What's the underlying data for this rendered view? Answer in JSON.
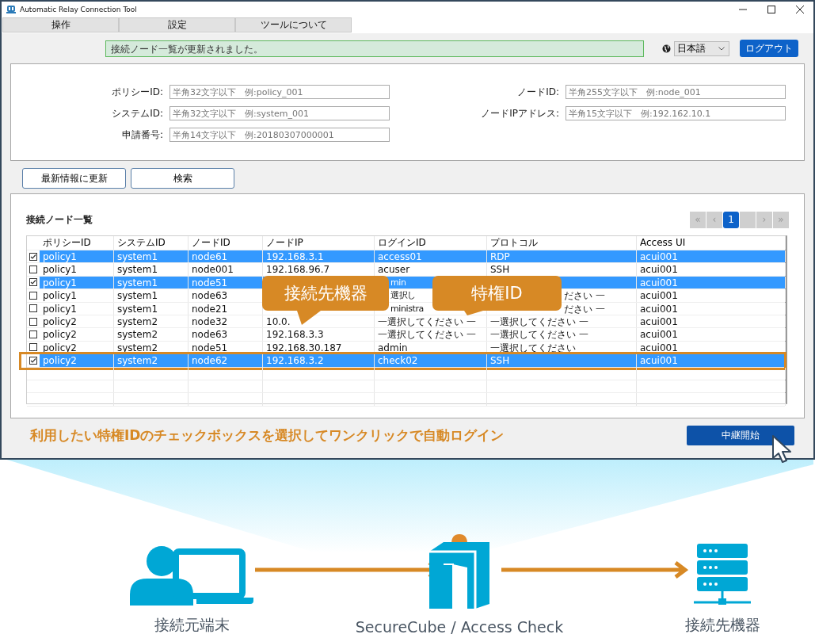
{
  "window": {
    "title": "Automatic Relay Connection Tool"
  },
  "menu_tabs": [
    {
      "label": "操作"
    },
    {
      "label": "設定"
    },
    {
      "label": "ツールについて"
    }
  ],
  "status_message": "接続ノード一覧が更新されました。",
  "language_select": {
    "value": "日本語"
  },
  "logout_button": "ログアウト",
  "search_fields_left": [
    {
      "label": "ポリシーID:",
      "placeholder": "半角32文字以下　例:policy_001"
    },
    {
      "label": "システムID:",
      "placeholder": "半角32文字以下　例:system_001"
    },
    {
      "label": "申請番号:",
      "placeholder": "半角14文字以下　例:20180307000001"
    }
  ],
  "search_fields_right": [
    {
      "label": "ノードID:",
      "placeholder": "半角255文字以下　例:node_001"
    },
    {
      "label": "ノードIPアドレス:",
      "placeholder": "半角15文字以下　例:192.162.10.1"
    }
  ],
  "buttons": [
    "最新情報に更新",
    "検索"
  ],
  "node_list": {
    "title": "接続ノード一覧",
    "pager": [
      {
        "label": "«",
        "selected": false
      },
      {
        "label": "‹",
        "selected": false
      },
      {
        "label": "1",
        "selected": true
      },
      {
        "selected": false
      },
      {
        "label": "›",
        "selected": false
      },
      {
        "label": "»",
        "selected": false
      }
    ],
    "columns": [
      "ポリシーID",
      "システムID",
      "ノードID",
      "ノードIP",
      "ログインID",
      "プロトコル",
      "Access UI"
    ],
    "rows": [
      {
        "checked": true,
        "selected": true,
        "highlighted": false,
        "cells": [
          "policy1",
          "system1",
          "node61",
          "192.168.3.1",
          "access01",
          "RDP",
          "acui001"
        ],
        "cut_login": false,
        "cut_protocol": false
      },
      {
        "checked": false,
        "selected": false,
        "highlighted": false,
        "cells": [
          "policy1",
          "system1",
          "node001",
          "192.168.96.7",
          "acuser",
          "SSH",
          "acui001"
        ],
        "cut_login": false,
        "cut_protocol": false
      },
      {
        "checked": true,
        "selected": true,
        "highlighted": false,
        "cells": [
          "policy1",
          "system1",
          "node51",
          null,
          "min",
          null,
          "acui001"
        ],
        "cut_login": true,
        "cut_protocol": false
      },
      {
        "checked": false,
        "selected": false,
        "highlighted": false,
        "cells": [
          "policy1",
          "system1",
          "node63",
          null,
          "選択し",
          "ださい 一",
          "acui001"
        ],
        "cut_login": true,
        "cut_protocol": true
      },
      {
        "checked": false,
        "selected": false,
        "highlighted": false,
        "cells": [
          "policy1",
          "system1",
          "node21",
          null,
          "ministra",
          "ださい 一",
          "acui001"
        ],
        "cut_login": true,
        "cut_protocol": true
      },
      {
        "checked": false,
        "selected": false,
        "highlighted": false,
        "cells": [
          "policy2",
          "system2",
          "node32",
          "10.0.",
          "一選択してください 一",
          "一選択してください 一",
          "acui001"
        ],
        "cut_login": false,
        "cut_protocol": false
      },
      {
        "checked": false,
        "selected": false,
        "highlighted": false,
        "cells": [
          "policy2",
          "system2",
          "node63",
          "192.168.3.3",
          "一選択してください 一",
          "一選択してください 一",
          "acui001"
        ],
        "cut_login": false,
        "cut_protocol": false
      },
      {
        "checked": false,
        "selected": false,
        "highlighted": false,
        "cells": [
          "policy2",
          "system2",
          "node51",
          "192.168.30.187",
          "admin",
          "一選択してください",
          "acui001"
        ],
        "cut_login": false,
        "cut_protocol": false
      },
      {
        "checked": true,
        "selected": true,
        "highlighted": true,
        "cells": [
          "policy2",
          "system2",
          "node62",
          "192.168.3.2",
          "check02",
          "SSH",
          "acui001"
        ],
        "cut_login": false,
        "cut_protocol": false
      }
    ]
  },
  "callouts": [
    {
      "text": "接続先機器"
    },
    {
      "text": "特権ID"
    }
  ],
  "instruction": "利用したい特権IDのチェックボックスを選択してワンクリックで自動ログイン",
  "start_button": "中継開始",
  "diagram": {
    "nodes": [
      {
        "kind": "terminal",
        "label": "接続元端末"
      },
      {
        "kind": "gateway",
        "label": "SecureCube / Access Check"
      },
      {
        "kind": "server",
        "label": "接続先機器"
      }
    ]
  }
}
